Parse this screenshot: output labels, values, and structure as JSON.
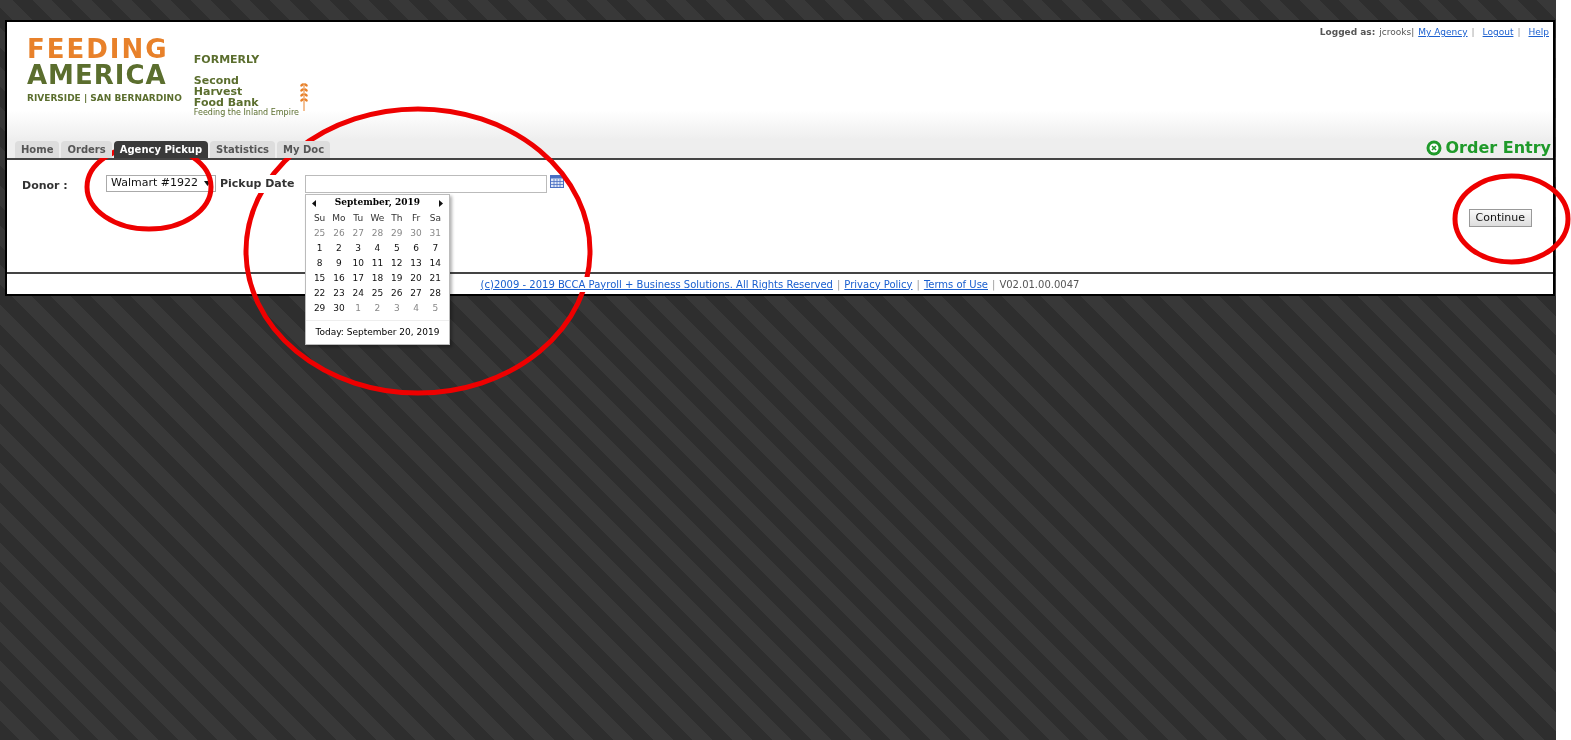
{
  "header": {
    "logo": {
      "line1": "FEEDING",
      "line2": "AMERICA",
      "line3": "RIVERSIDE | SAN BERNARDINO"
    },
    "formerly": {
      "label": "FORMERLY",
      "name_lines": [
        "Second",
        "Harvest",
        "Food Bank"
      ],
      "tagline": "Feeding the Inland Empire"
    },
    "user_bar": {
      "label": "Logged as:",
      "user": "jcrooks|",
      "links": [
        "My Agency",
        "Logout",
        "Help"
      ],
      "separator": "|"
    },
    "tabs": [
      {
        "label": "Home",
        "selected": false
      },
      {
        "label": "Orders",
        "selected": false
      },
      {
        "label": "Agency Pickup",
        "selected": true
      },
      {
        "label": "Statistics",
        "selected": false
      },
      {
        "label": "My Doc",
        "selected": false
      }
    ],
    "page_title": "Order Entry"
  },
  "form": {
    "donor_label": "Donor :",
    "donor_value": "Walmart #1922",
    "date_label": "Pickup Date",
    "continue_button": "Continue"
  },
  "calendar": {
    "month": "September, 2019",
    "weekdays": [
      "Su",
      "Mo",
      "Tu",
      "We",
      "Th",
      "Fr",
      "Sa"
    ],
    "weeks": [
      [
        {
          "day": "25",
          "current": false
        },
        {
          "day": "26",
          "current": false
        },
        {
          "day": "27",
          "current": false
        },
        {
          "day": "28",
          "current": false
        },
        {
          "day": "29",
          "current": false
        },
        {
          "day": "30",
          "current": false
        },
        {
          "day": "31",
          "current": false
        }
      ],
      [
        {
          "day": "1",
          "current": true
        },
        {
          "day": "2",
          "current": true
        },
        {
          "day": "3",
          "current": true
        },
        {
          "day": "4",
          "current": true
        },
        {
          "day": "5",
          "current": true
        },
        {
          "day": "6",
          "current": true
        },
        {
          "day": "7",
          "current": true
        }
      ],
      [
        {
          "day": "8",
          "current": true
        },
        {
          "day": "9",
          "current": true
        },
        {
          "day": "10",
          "current": true
        },
        {
          "day": "11",
          "current": true
        },
        {
          "day": "12",
          "current": true
        },
        {
          "day": "13",
          "current": true
        },
        {
          "day": "14",
          "current": true
        }
      ],
      [
        {
          "day": "15",
          "current": true
        },
        {
          "day": "16",
          "current": true
        },
        {
          "day": "17",
          "current": true
        },
        {
          "day": "18",
          "current": true
        },
        {
          "day": "19",
          "current": true
        },
        {
          "day": "20",
          "current": true
        },
        {
          "day": "21",
          "current": true
        }
      ],
      [
        {
          "day": "22",
          "current": true
        },
        {
          "day": "23",
          "current": true
        },
        {
          "day": "24",
          "current": true
        },
        {
          "day": "25",
          "current": true
        },
        {
          "day": "26",
          "current": true
        },
        {
          "day": "27",
          "current": true
        },
        {
          "day": "28",
          "current": true
        }
      ],
      [
        {
          "day": "29",
          "current": true
        },
        {
          "day": "30",
          "current": true
        },
        {
          "day": "1",
          "current": false
        },
        {
          "day": "2",
          "current": false
        },
        {
          "day": "3",
          "current": false
        },
        {
          "day": "4",
          "current": false
        },
        {
          "day": "5",
          "current": false
        }
      ]
    ],
    "today": "Today: September 20, 2019"
  },
  "footer": {
    "copyright": "(c)2009 - 2019 BCCA Payroll + Business Solutions. All Rights Reserved",
    "links": [
      "Privacy Policy",
      "Terms of Use"
    ],
    "separator": "|",
    "version": "V02.01.00.0047"
  }
}
